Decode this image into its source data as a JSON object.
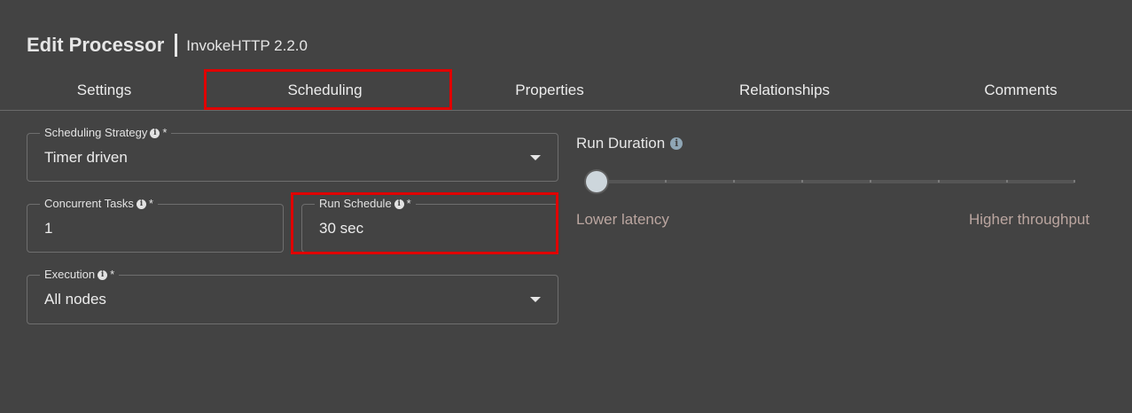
{
  "dialog": {
    "title": "Edit Processor",
    "subtitle": "InvokeHTTP 2.2.0"
  },
  "tabs": [
    {
      "label": "Settings"
    },
    {
      "label": "Scheduling",
      "active": true
    },
    {
      "label": "Properties"
    },
    {
      "label": "Relationships"
    },
    {
      "label": "Comments"
    }
  ],
  "form": {
    "scheduling_strategy": {
      "label": "Scheduling Strategy",
      "required": "*",
      "value": "Timer driven"
    },
    "concurrent_tasks": {
      "label": "Concurrent Tasks",
      "required": "*",
      "value": "1"
    },
    "run_schedule": {
      "label": "Run Schedule",
      "required": "*",
      "value": "30 sec"
    },
    "execution": {
      "label": "Execution",
      "required": "*",
      "value": "All nodes"
    }
  },
  "run_duration": {
    "label": "Run Duration",
    "min_caption": "Lower latency",
    "max_caption": "Higher throughput",
    "position_fraction": 0
  },
  "icons": {
    "info": "info-circle-icon",
    "dropdown": "caret-down-icon"
  },
  "colors": {
    "background": "#434343",
    "highlight": "#e00000",
    "caption": "#bba6a0",
    "slider_thumb": "#cdd6dc"
  }
}
